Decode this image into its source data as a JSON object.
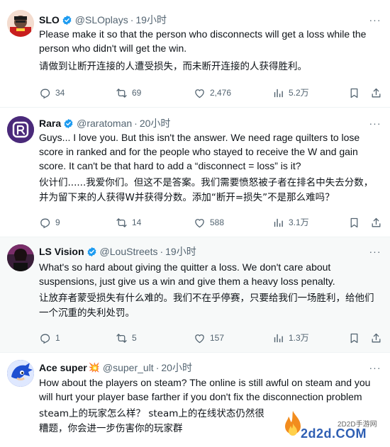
{
  "tweets": [
    {
      "name": "SLO",
      "handle": "@SLOplays",
      "time": "19小时",
      "text_en": "Please make it so that the person who disconnects will get a loss while the person who didn't will get the win.",
      "text_zh": "请做到让断开连接的人遭受损失，而未断开连接的人获得胜利。",
      "replies": "34",
      "reposts": "69",
      "likes": "2,476",
      "views": "5.2万"
    },
    {
      "name": "Rara",
      "handle": "@raratoman",
      "time": "20小时",
      "text_en": "Guys... I love you. But this isn't the answer. We need rage quilters to lose score in ranked and for the people who stayed to receive the W and gain score. It can't be that hard to add a “disconnect = loss” is it?",
      "text_zh": "伙计们......我爱你们。但这不是答案。我们需要愤怒被子者在排名中失去分数，并为留下来的人获得W并获得分数。添加“断开=损失”不是那么难吗？",
      "replies": "9",
      "reposts": "14",
      "likes": "588",
      "views": "3.1万"
    },
    {
      "name": "LS Vision",
      "handle": "@LouStreets",
      "time": "19小时",
      "text_en": "What's so hard about giving the quitter a loss. We don't care about suspensions, just give us a win and give them a heavy loss penalty.",
      "text_zh": "让放弃者蒙受损失有什么难的。我们不在乎停赛，只要给我们一场胜利，给他们一个沉重的失利处罚。",
      "replies": "1",
      "reposts": "5",
      "likes": "157",
      "views": "1.3万"
    },
    {
      "name": "Ace super",
      "name_emoji": "💥",
      "handle": "@super_ult",
      "time": "20小时",
      "text_en": "How about the players on steam? The online is still awful on steam and you will hurt your player base farther if you don't fix the disconnection problem",
      "text_zh": "steam上的玩家怎么样？ steam上的在线状态仍然很糟题，你会进一步伤害你的玩家群"
    }
  ],
  "separator": "·",
  "more_glyph": "···",
  "watermark": {
    "site": "2D2D手游网",
    "domain": "2d2d.COM"
  },
  "colors": {
    "verified": "#1d9bf0",
    "secondary_text": "#536471",
    "highlight_bg": "#f7f9f9"
  },
  "icons": [
    "reply-icon",
    "repost-icon",
    "like-icon",
    "views-icon",
    "bookmark-icon",
    "share-icon",
    "verified-badge-icon",
    "more-icon"
  ]
}
